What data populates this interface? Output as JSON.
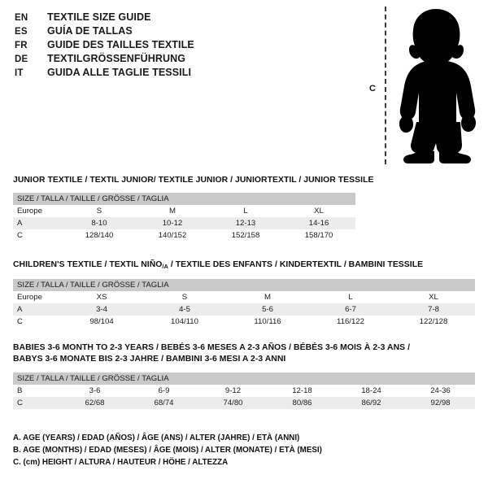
{
  "languages": [
    {
      "code": "EN",
      "title": "TEXTILE SIZE GUIDE"
    },
    {
      "code": "ES",
      "title": "GUÍA DE TALLAS"
    },
    {
      "code": "FR",
      "title": "GUIDE DES TAILLES TEXTILE"
    },
    {
      "code": "DE",
      "title": "TEXTILGRÖSSENFÜHRUNG"
    },
    {
      "code": "IT",
      "title": "GUIDA ALLE TAGLIE TESSILI"
    }
  ],
  "figure": {
    "height_label": "C",
    "icon": "child-silhouette-icon",
    "measure_line": "height-dashed-line"
  },
  "sections": {
    "junior": {
      "heading": "JUNIOR TEXTILE / TEXTIL JUNIOR/ TEXTILE JUNIOR / JUNIORTEXTIL / JUNIOR TESSILE",
      "size_bar": "SIZE / TALLA / TAILLE / GRÖSSE / TAGLIA",
      "rows": [
        {
          "label": "Europe",
          "values": [
            "S",
            "M",
            "L",
            "XL"
          ]
        },
        {
          "label": "A",
          "values": [
            "8-10",
            "10-12",
            "12-13",
            "14-16"
          ]
        },
        {
          "label": "C",
          "values": [
            "128/140",
            "140/152",
            "152/158",
            "158/170"
          ]
        }
      ]
    },
    "children": {
      "heading_pre": "CHILDREN'S TEXTILE / TEXTIL NIÑO",
      "heading_sub": "/A",
      "heading_post": " / TEXTILE DES ENFANTS / KINDERTEXTIL / BAMBINI TESSILE",
      "size_bar": "SIZE / TALLA / TAILLE / GRÖSSE / TAGLIA",
      "rows": [
        {
          "label": "Europe",
          "values": [
            "XS",
            "S",
            "M",
            "L",
            "XL"
          ]
        },
        {
          "label": "A",
          "values": [
            "3-4",
            "4-5",
            "5-6",
            "6-7",
            "7-8"
          ]
        },
        {
          "label": "C",
          "values": [
            "98/104",
            "104/110",
            "110/116",
            "116/122",
            "122/128"
          ]
        }
      ]
    },
    "babies": {
      "heading_line1": "BABIES 3-6 MONTH TO 2-3 YEARS / BEBÉS 3-6 MESES A 2-3 AÑOS / BÉBÉS 3-6 MOIS À 2-3 ANS /",
      "heading_line2": "BABYS 3-6 MONATE BIS 2-3 JAHRE / BAMBINI 3-6 MESI A 2-3 ANNI",
      "size_bar": "SIZE / TALLA / TAILLE / GRÖSSE / TAGLIA",
      "rows": [
        {
          "label": "B",
          "values": [
            "3-6",
            "6-9",
            "9-12",
            "12-18",
            "18-24",
            "24-36"
          ]
        },
        {
          "label": "C",
          "values": [
            "62/68",
            "68/74",
            "74/80",
            "80/86",
            "86/92",
            "92/98"
          ]
        }
      ]
    }
  },
  "legend": [
    "A. AGE (YEARS) / EDAD (AÑOS) / ÂGE (ANS) / ALTER (JAHRE) / ETÀ (ANNI)",
    "B. AGE (MONTHS) / EDAD (MESES) / ÂGE (MOIS) / ALTER (MONATE) / ETÀ (MESI)",
    "C. (cm) HEIGHT / ALTURA / HAUTEUR / HÖHE / ALTEZZA"
  ],
  "colors": {
    "header_bar": "#c9c9c9",
    "row_shade": "#ececec",
    "text": "#1a1a1a",
    "silhouette": "#000000"
  }
}
